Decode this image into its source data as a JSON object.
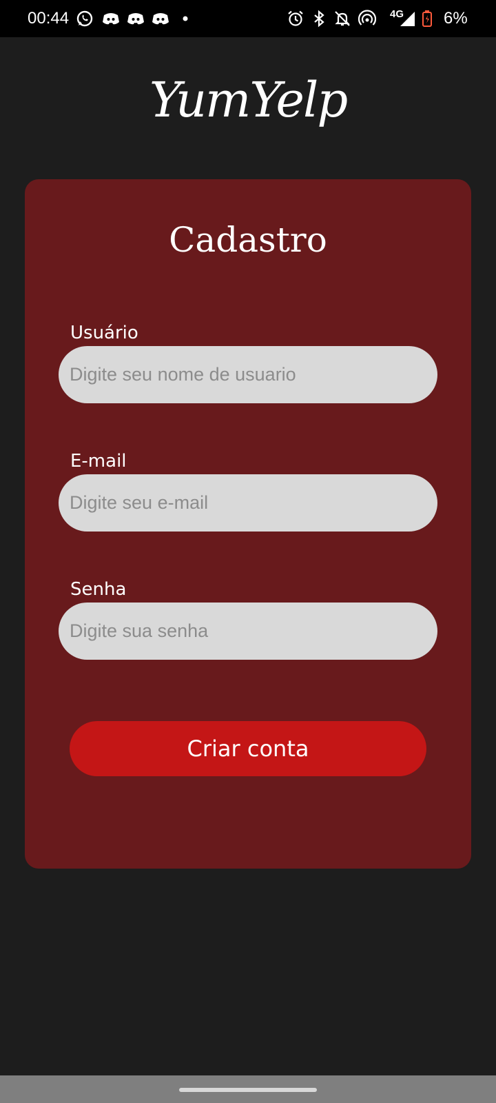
{
  "status_bar": {
    "time": "00:44",
    "network": "4G",
    "battery": "6%",
    "left_icons": [
      "whatsapp-icon",
      "discord-icon",
      "discord-icon",
      "discord-icon",
      "dot-icon"
    ],
    "right_icons": [
      "alarm-icon",
      "bluetooth-icon",
      "notifications-off-icon",
      "hotspot-icon",
      "signal-icon",
      "battery-icon"
    ]
  },
  "app": {
    "logo": "YumYelp"
  },
  "form": {
    "title": "Cadastro",
    "username": {
      "label": "Usuário",
      "placeholder": "Digite seu nome de usuario",
      "value": ""
    },
    "email": {
      "label": "E-mail",
      "placeholder": "Digite seu e-mail",
      "value": ""
    },
    "password": {
      "label": "Senha",
      "placeholder": "Digite sua senha",
      "value": ""
    },
    "submit_label": "Criar conta"
  },
  "colors": {
    "background": "#1d1d1d",
    "card": "#681a1c",
    "button": "#c41616",
    "input": "#d9d9d9"
  }
}
